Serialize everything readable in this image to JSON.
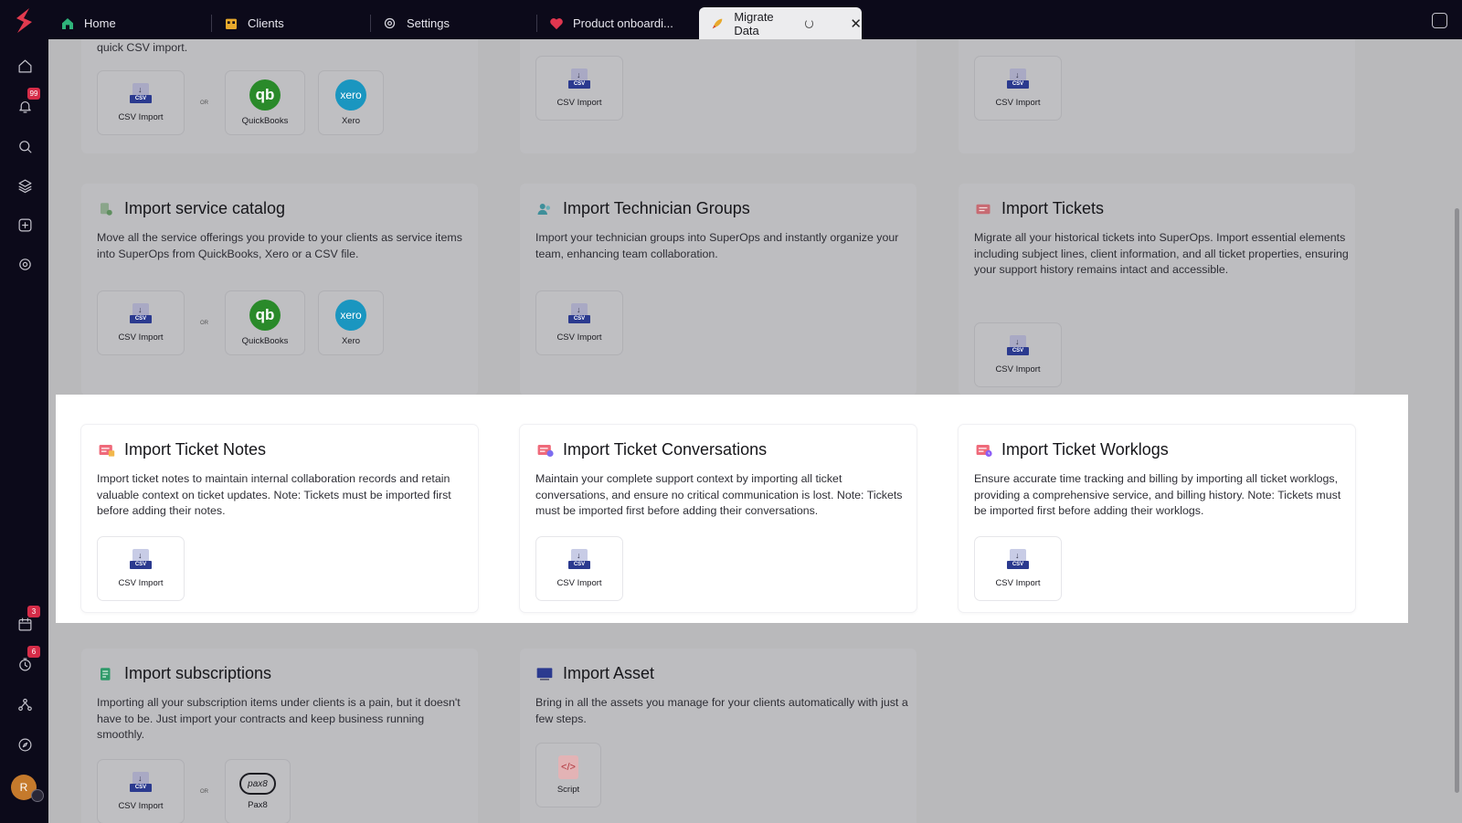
{
  "sidebar": {
    "notifications_badge": "99",
    "calendar_badge": "3",
    "timer_badge": "6",
    "avatar_initial": "R"
  },
  "tabs": [
    {
      "label": "Home",
      "icon": "home-icon"
    },
    {
      "label": "Clients",
      "icon": "building-icon"
    },
    {
      "label": "Settings",
      "icon": "gear-icon"
    },
    {
      "label": "Product onboardi...",
      "icon": "heart-icon"
    },
    {
      "label": "Migrate Data",
      "icon": "rocket-icon",
      "active": true
    }
  ],
  "top": {
    "card1_partial_text": "quick CSV import.",
    "csv": "CSV Import",
    "quickbooks": "QuickBooks",
    "xero": "Xero",
    "or": "OR"
  },
  "cards": {
    "service_catalog": {
      "title": "Import service catalog",
      "desc": "Move all the service offerings you provide to your clients as service items into SuperOps from QuickBooks, Xero or a CSV file."
    },
    "technician_groups": {
      "title": "Import Technician Groups",
      "desc": "Import your technician groups into SuperOps and instantly organize your team, enhancing team collaboration."
    },
    "tickets": {
      "title": "Import Tickets",
      "desc": "Migrate all your historical tickets into SuperOps. Import essential elements including subject lines, client information, and all ticket properties, ensuring your support history remains intact and accessible."
    },
    "ticket_notes": {
      "title": "Import Ticket Notes",
      "desc": "Import ticket notes to maintain internal collaboration records and retain valuable context on ticket updates. Note: Tickets must be imported first before adding their notes."
    },
    "ticket_conversations": {
      "title": "Import Ticket Conversations",
      "desc": "Maintain your complete support context by importing all ticket conversations, and ensure no critical communication is lost. Note: Tickets must be imported first before adding their conversations."
    },
    "ticket_worklogs": {
      "title": "Import Ticket Worklogs",
      "desc": "Ensure accurate time tracking and billing by importing all ticket worklogs, providing a comprehensive service, and billing history. Note: Tickets must be imported first before adding their worklogs."
    },
    "subscriptions": {
      "title": "Import subscriptions",
      "desc": "Importing all your subscription items under clients is a pain, but it doesn't have to be. Just import your contracts and keep business running smoothly."
    },
    "asset": {
      "title": "Import Asset",
      "desc": "Bring in all the assets you manage for your clients automatically with just a few steps."
    }
  },
  "tiles": {
    "csv": "CSV Import",
    "quickbooks": "QuickBooks",
    "xero": "Xero",
    "pax8": "Pax8",
    "script": "Script",
    "or": "OR",
    "qb_glyph": "qb",
    "xero_glyph": "xero",
    "pax8_glyph": "pax8",
    "csv_band": "CSV",
    "script_glyph": "</>"
  },
  "colors": {
    "sidebar_bg": "#0c0a1a",
    "highlight_bg": "#ffffff",
    "dim_bg": "#b9b9bb",
    "badge": "#d62c48",
    "csv_band": "#2b3a8f",
    "quickbooks": "#2a8a2a",
    "xero": "#1a96c0"
  }
}
